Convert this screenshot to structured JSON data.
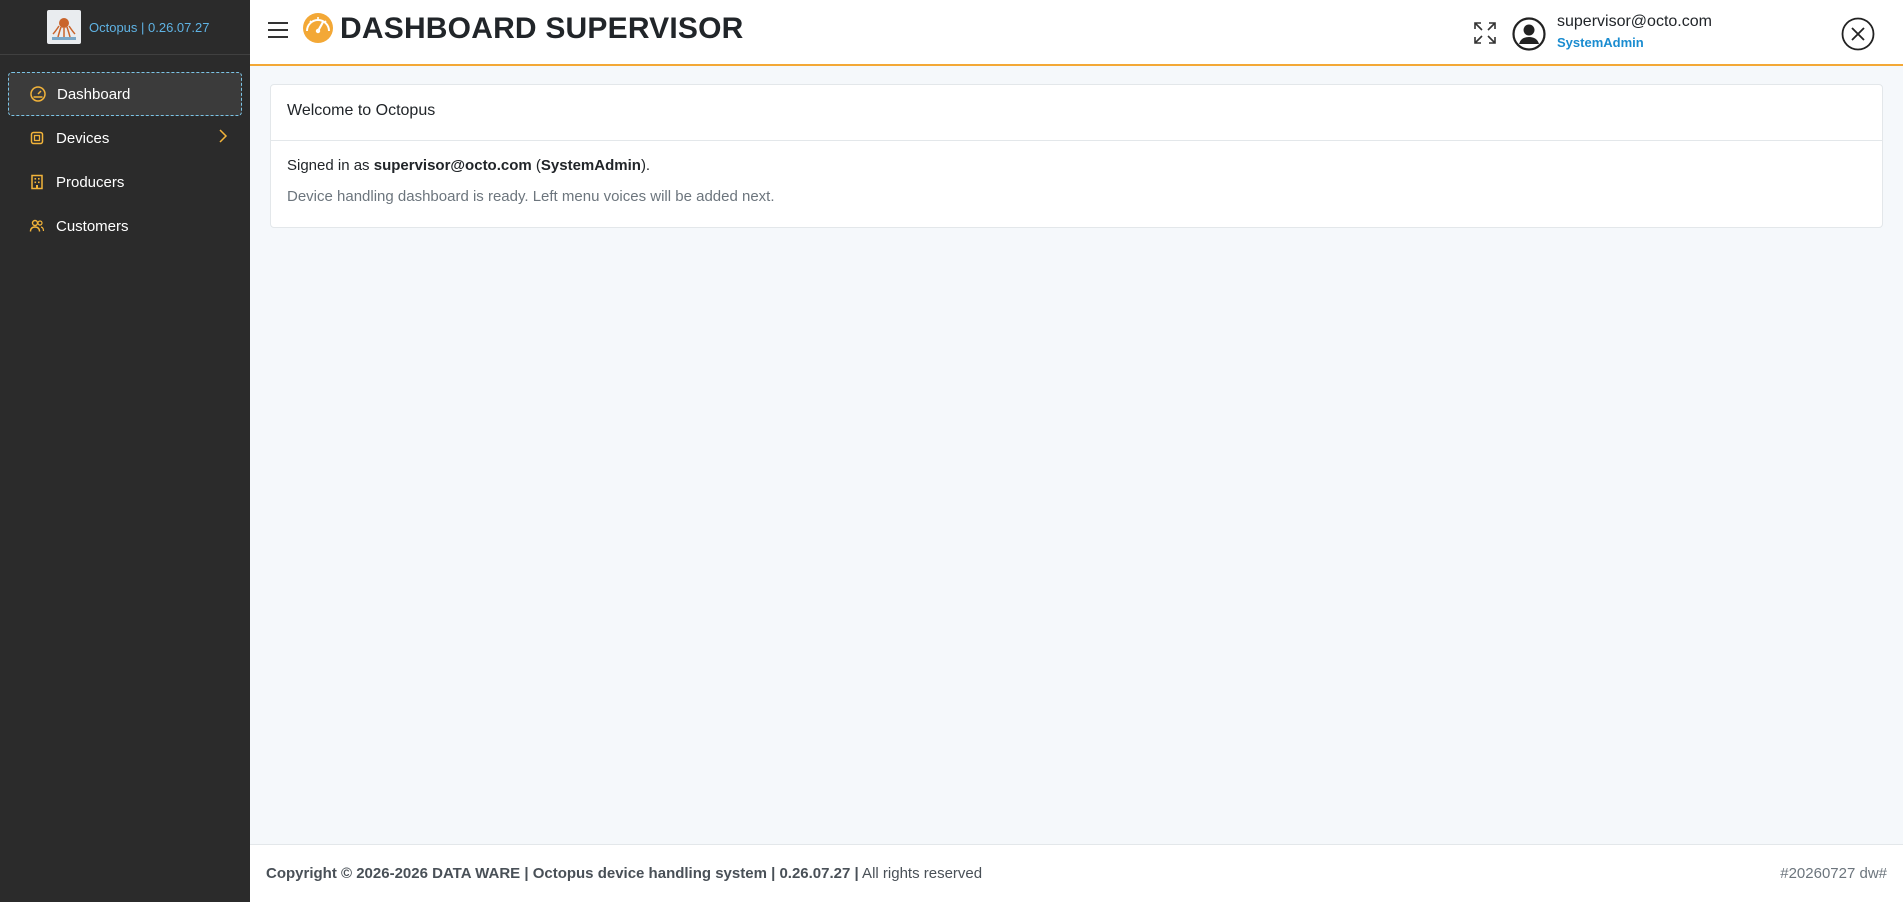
{
  "brand": {
    "text": "Octopus | 0.26.07.27",
    "logo_icon": "octopus-logo"
  },
  "sidebar": {
    "items": [
      {
        "label": "Dashboard",
        "icon": "dashboard-gauge-icon",
        "active": true
      },
      {
        "label": "Devices",
        "icon": "chip-icon",
        "has_children": true
      },
      {
        "label": "Producers",
        "icon": "building-icon"
      },
      {
        "label": "Customers",
        "icon": "users-icon"
      }
    ]
  },
  "header": {
    "title": "DASHBOARD SUPERVISOR",
    "title_icon": "speedometer-icon",
    "user_email": "supervisor@octo.com",
    "user_role": "SystemAdmin"
  },
  "card": {
    "title": "Welcome to Octopus",
    "signed_prefix": "Signed in as ",
    "signed_email": "supervisor@octo.com",
    "signed_open": " (",
    "signed_role": "SystemAdmin",
    "signed_close": ").",
    "note": "Device handling dashboard is ready. Left menu voices will be added next."
  },
  "footer": {
    "copyright": "Copyright © 2026-2026 DATA WARE | Octopus device handling system | 0.26.07.27 |",
    "rights": " All rights reserved",
    "build": "#20260727 dw#"
  },
  "colors": {
    "sidebar_bg": "#2b2b2b",
    "accent": "#f3a836",
    "link": "#1a8cd0",
    "brand_text": "#5fb3e4"
  }
}
